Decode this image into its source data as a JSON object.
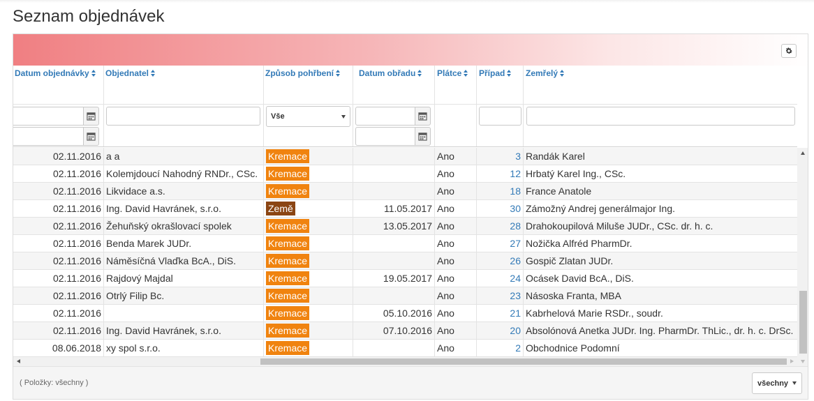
{
  "page": {
    "title": "Seznam objednávek"
  },
  "table": {
    "columns": [
      {
        "key": "datum",
        "label": "Datum objednávky"
      },
      {
        "key": "objednatel",
        "label": "Objednatel"
      },
      {
        "key": "zpusob",
        "label": "Způsob pohřbení"
      },
      {
        "key": "obrad",
        "label": "Datum obřadu"
      },
      {
        "key": "platce",
        "label": "Plátce"
      },
      {
        "key": "pripad",
        "label": "Případ"
      },
      {
        "key": "zemrely",
        "label": "Zemřelý"
      }
    ],
    "filters": {
      "zpusob_selected": "Vše"
    },
    "rows": [
      {
        "datum": "02.11.2016",
        "objednatel": "a a",
        "zpusob": "Kremace",
        "obrad": "",
        "platce": "Ano",
        "pripad": "3",
        "zemrely": "Randák Karel"
      },
      {
        "datum": "02.11.2016",
        "objednatel": "Kolemjdoucí Nahodný RNDr., CSc.",
        "zpusob": "Kremace",
        "obrad": "",
        "platce": "Ano",
        "pripad": "12",
        "zemrely": "Hrbatý Karel Ing., CSc."
      },
      {
        "datum": "02.11.2016",
        "objednatel": "Likvidace a.s.",
        "zpusob": "Kremace",
        "obrad": "",
        "platce": "Ano",
        "pripad": "18",
        "zemrely": "France Anatole"
      },
      {
        "datum": "02.11.2016",
        "objednatel": "Ing. David Havránek, s.r.o.",
        "zpusob": "Země",
        "obrad": "11.05.2017",
        "platce": "Ano",
        "pripad": "30",
        "zemrely": "Zámožný Andrej generálmajor Ing."
      },
      {
        "datum": "02.11.2016",
        "objednatel": "Žehuňský okrašlovací spolek",
        "zpusob": "Kremace",
        "obrad": "13.05.2017",
        "platce": "Ano",
        "pripad": "28",
        "zemrely": "Drahokoupilová Miluše JUDr., CSc. dr. h. c."
      },
      {
        "datum": "02.11.2016",
        "objednatel": "Benda Marek JUDr.",
        "zpusob": "Kremace",
        "obrad": "",
        "platce": "Ano",
        "pripad": "27",
        "zemrely": "Nožička Alfréd PharmDr."
      },
      {
        "datum": "02.11.2016",
        "objednatel": "Náměsíčná Vlaďka BcA., DiS.",
        "zpusob": "Kremace",
        "obrad": "",
        "platce": "Ano",
        "pripad": "26",
        "zemrely": "Gospič Zlatan JUDr."
      },
      {
        "datum": "02.11.2016",
        "objednatel": "Rajdový Majdal",
        "zpusob": "Kremace",
        "obrad": "19.05.2017",
        "platce": "Ano",
        "pripad": "24",
        "zemrely": "Ocásek David BcA., DiS."
      },
      {
        "datum": "02.11.2016",
        "objednatel": "Otrlý Filip Bc.",
        "zpusob": "Kremace",
        "obrad": "",
        "platce": "Ano",
        "pripad": "23",
        "zemrely": "Násoska Franta, MBA"
      },
      {
        "datum": "02.11.2016",
        "objednatel": "",
        "zpusob": "Kremace",
        "obrad": "05.10.2016",
        "platce": "Ano",
        "pripad": "21",
        "zemrely": "Kabrhelová Marie RSDr., soudr."
      },
      {
        "datum": "02.11.2016",
        "objednatel": "Ing. David Havránek, s.r.o.",
        "zpusob": "Kremace",
        "obrad": "07.10.2016",
        "platce": "Ano",
        "pripad": "20",
        "zemrely": "Absolónová Anetka JUDr. Ing. PharmDr. ThLic., dr. h. c. DrSc."
      },
      {
        "datum": "08.06.2018",
        "objednatel": "xy spol s.r.o.",
        "zpusob": "Kremace",
        "obrad": "",
        "platce": "Ano",
        "pripad": "2",
        "zemrely": "Obchodnice Podomní"
      }
    ]
  },
  "footer": {
    "items_label": "( Položky: všechny )",
    "page_size": "všechny"
  },
  "colors": {
    "kremace": "#f0830f",
    "zeme": "#8b4513",
    "link": "#337ab7"
  },
  "icons": {
    "settings": "gear-icon",
    "calendar": "calendar-icon",
    "sort": "sort-icon"
  }
}
